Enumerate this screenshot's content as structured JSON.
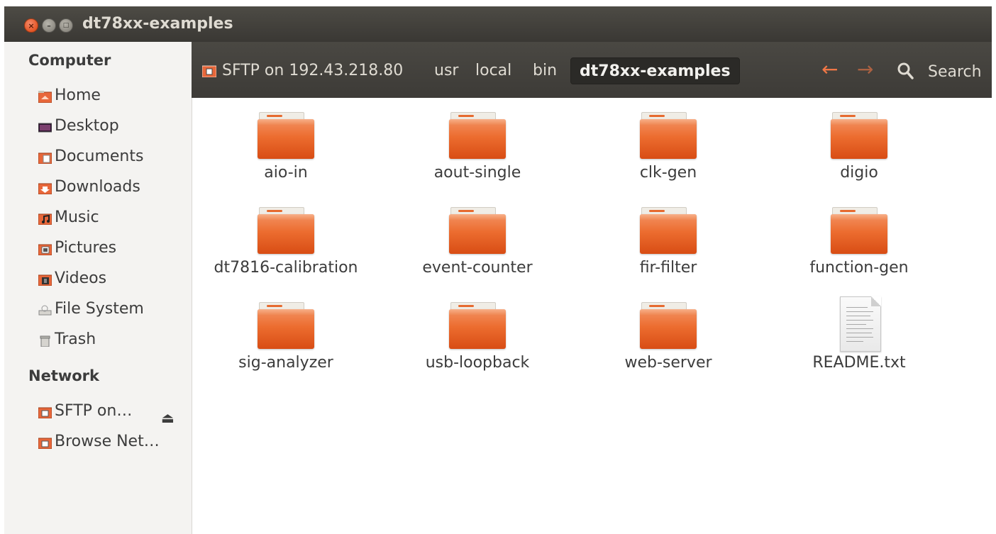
{
  "window": {
    "title": "dt78xx-examples"
  },
  "window_controls": {
    "close": "×",
    "minimize": "–",
    "maximize": "□"
  },
  "sidebar": {
    "computer_header": "Computer",
    "computer_items": [
      {
        "label": "Home",
        "icon": "home-folder-icon"
      },
      {
        "label": "Desktop",
        "icon": "desktop-icon"
      },
      {
        "label": "Documents",
        "icon": "documents-folder-icon"
      },
      {
        "label": "Downloads",
        "icon": "downloads-folder-icon"
      },
      {
        "label": "Music",
        "icon": "music-folder-icon"
      },
      {
        "label": "Pictures",
        "icon": "pictures-folder-icon"
      },
      {
        "label": "Videos",
        "icon": "videos-folder-icon"
      },
      {
        "label": "File System",
        "icon": "drive-icon"
      },
      {
        "label": "Trash",
        "icon": "trash-icon"
      }
    ],
    "network_header": "Network",
    "network_items": [
      {
        "label": "SFTP on…",
        "icon": "network-folder-icon"
      },
      {
        "label": "Browse Net…",
        "icon": "network-folder-icon"
      }
    ],
    "eject_glyph": "⏏"
  },
  "breadcrumb": [
    "SFTP on 192.43.218.80",
    "usr",
    "local",
    "bin",
    "dt78xx-examples"
  ],
  "toolbar": {
    "back_glyph": "←",
    "forward_glyph": "→",
    "search_label": "Search"
  },
  "files": [
    {
      "name": "aio-in",
      "type": "folder"
    },
    {
      "name": "aout-single",
      "type": "folder"
    },
    {
      "name": "clk-gen",
      "type": "folder"
    },
    {
      "name": "digio",
      "type": "folder"
    },
    {
      "name": "dt7816-calibration",
      "type": "folder"
    },
    {
      "name": "event-counter",
      "type": "folder"
    },
    {
      "name": "fir-filter",
      "type": "folder"
    },
    {
      "name": "function-gen",
      "type": "folder"
    },
    {
      "name": "sig-analyzer",
      "type": "folder"
    },
    {
      "name": "usb-loopback",
      "type": "folder"
    },
    {
      "name": "web-server",
      "type": "folder"
    },
    {
      "name": "README.txt",
      "type": "text-file"
    }
  ],
  "colors": {
    "accent": "#e95420",
    "titlebar": "#3c3b37",
    "sidebar": "#f4f3f1"
  }
}
